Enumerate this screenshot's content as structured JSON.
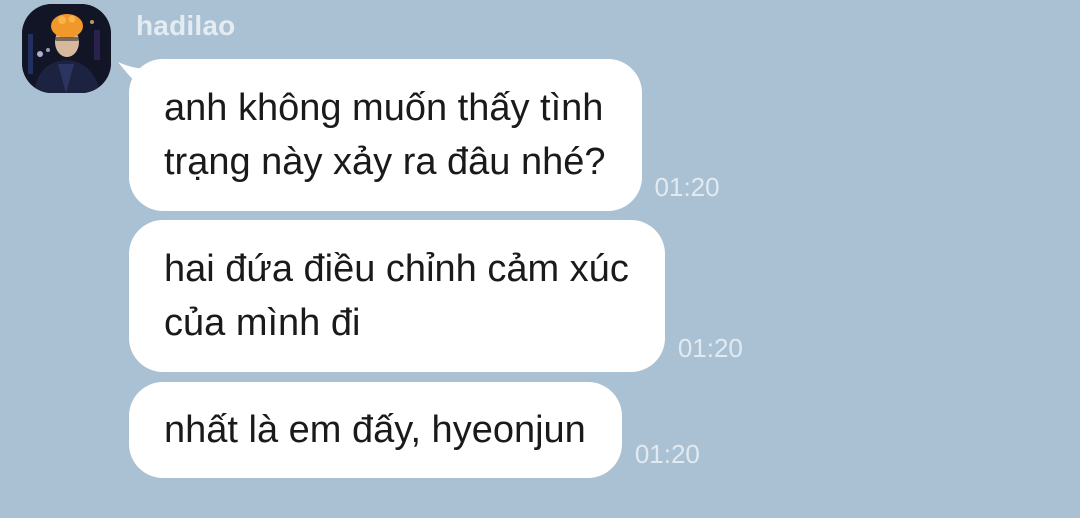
{
  "chat": {
    "sender": {
      "name": "hadilao",
      "avatar_icon": "profile-photo"
    },
    "messages": [
      {
        "text": "anh không muốn thấy tình\ntrạng này xảy ra đâu nhé?",
        "time": "01:20"
      },
      {
        "text": "hai đứa điều chỉnh cảm xúc\ncủa mình đi",
        "time": "01:20"
      },
      {
        "text": "nhất là em đấy, hyeonjun",
        "time": "01:20"
      }
    ]
  },
  "colors": {
    "background": "#a9c1d3",
    "bubble": "#ffffff",
    "text": "#1a1a1a",
    "meta_text": "#e2eaf1"
  }
}
